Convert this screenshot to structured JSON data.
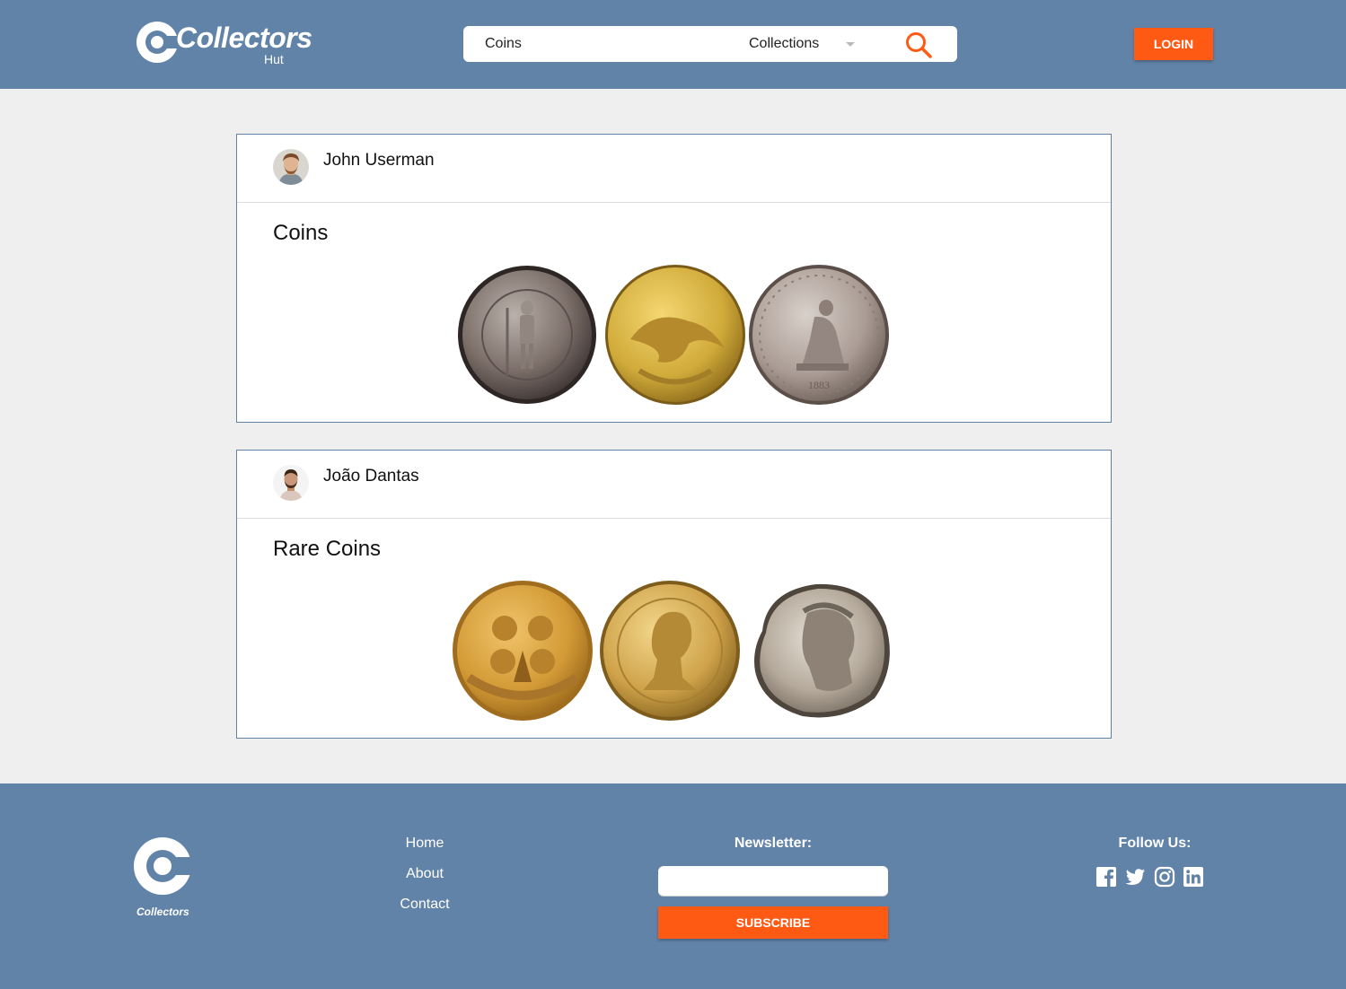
{
  "header": {
    "logo_word": "Collectors",
    "logo_sub": "Hut",
    "search_query": "Coins",
    "search_category": "Collections",
    "login_label": "LOGIN"
  },
  "posts": [
    {
      "user": "John Userman",
      "title": "Coins",
      "coins": [
        "silver-thaler-coin",
        "gold-eagle-coin",
        "trade-dollar-coin"
      ]
    },
    {
      "user": "João Dantas",
      "title": "Rare Coins",
      "coins": [
        "aviators-medal-coin",
        "gold-portrait-coin",
        "roman-denarius-coin"
      ]
    }
  ],
  "footer": {
    "logo_word": "Collectors",
    "nav": [
      "Home",
      "About",
      "Contact"
    ],
    "newsletter_label": "Newsletter:",
    "newsletter_value": "",
    "subscribe_label": "SUBSCRIBE",
    "follow_label": "Follow Us:",
    "social": [
      "facebook-icon",
      "twitter-icon",
      "instagram-icon",
      "linkedin-icon"
    ]
  },
  "colors": {
    "brand_blue": "#6283a8",
    "accent_orange": "#ff5a14",
    "page_bg": "#efefef"
  }
}
